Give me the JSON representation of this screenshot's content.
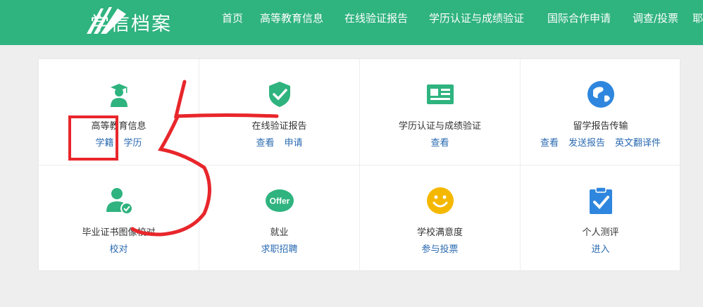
{
  "header": {
    "brand": "学信档案",
    "nav": [
      "首页",
      "高等教育信息",
      "在线验证报告",
      "学历认证与成绩验证",
      "国际合作申请",
      "调查/投票",
      "耶"
    ]
  },
  "services": [
    {
      "title": "高等教育信息",
      "icon": "graduate-icon",
      "links": [
        "学籍",
        "学历"
      ]
    },
    {
      "title": "在线验证报告",
      "icon": "shield-check-icon",
      "links": [
        "查看",
        "申请"
      ]
    },
    {
      "title": "学历认证与成绩验证",
      "icon": "id-card-icon",
      "links": [
        "查看"
      ]
    },
    {
      "title": "留学报告传输",
      "icon": "globe-icon",
      "links": [
        "查看",
        "发送报告",
        "英文翻译件"
      ]
    },
    {
      "title": "毕业证书图像校对",
      "icon": "user-check-icon",
      "links": [
        "校对"
      ]
    },
    {
      "title": "就业",
      "icon": "offer-icon",
      "icon_text": "Offer",
      "links": [
        "求职招聘"
      ]
    },
    {
      "title": "学校满意度",
      "icon": "smiley-icon",
      "links": [
        "参与投票"
      ]
    },
    {
      "title": "个人测评",
      "icon": "clipboard-check-icon",
      "links": [
        "进入"
      ]
    }
  ],
  "colors": {
    "header_bg": "#2fb37f",
    "link": "#2a6ab1",
    "icon_green": "#2fb37f",
    "icon_blue": "#2f86de",
    "icon_yellow": "#f5b800",
    "annotation_red": "#e8262b"
  }
}
